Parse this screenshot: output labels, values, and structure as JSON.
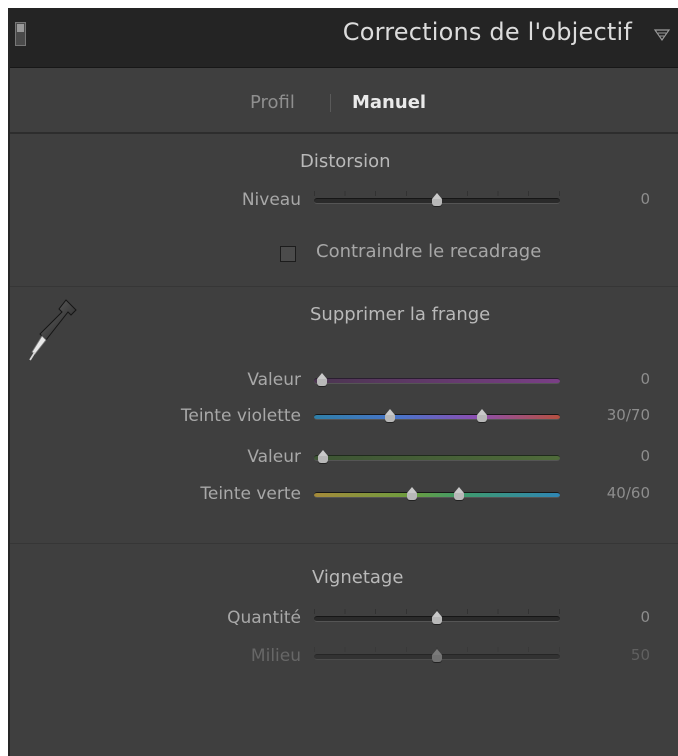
{
  "header": {
    "title": "Corrections de l'objectif"
  },
  "tabs": {
    "profil": "Profil",
    "manuel": "Manuel",
    "active": "Manuel"
  },
  "distortion": {
    "title": "Distorsion",
    "niveau": {
      "label": "Niveau",
      "value": "0",
      "position": 0.5
    },
    "constrain": {
      "label": "Contraindre le recadrage",
      "checked": false
    }
  },
  "defringe": {
    "title": "Supprimer la frange",
    "purple_amount": {
      "label": "Valeur",
      "value": "0",
      "position": 0.0
    },
    "purple_hue": {
      "label": "Teinte violette",
      "value": "30/70",
      "position_low": 0.3,
      "position_high": 0.7
    },
    "green_amount": {
      "label": "Valeur",
      "value": "0",
      "position": 0.0
    },
    "green_hue": {
      "label": "Teinte verte",
      "value": "40/60",
      "position_low": 0.4,
      "position_high": 0.6
    }
  },
  "vignetting": {
    "title": "Vignetage",
    "amount": {
      "label": "Quantité",
      "value": "0",
      "position": 0.5
    },
    "midpoint": {
      "label": "Milieu",
      "value": "50",
      "position": 0.5,
      "disabled": true
    }
  },
  "icons": {
    "collapse": "panel-collapse-icon",
    "header_arrow": "triangle-down-icon",
    "eyedropper": "eyedropper-icon"
  },
  "colors": {
    "panel_bg": "#3f3f3f",
    "header_bg": "#242424"
  }
}
